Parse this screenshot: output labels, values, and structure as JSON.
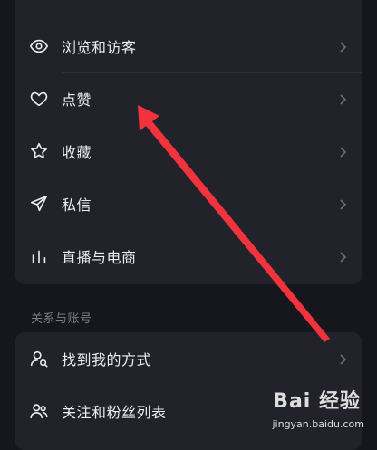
{
  "menu": {
    "items": [
      {
        "label": "浏览和访客",
        "icon": "eye-icon"
      },
      {
        "label": "点赞",
        "icon": "heart-icon"
      },
      {
        "label": "收藏",
        "icon": "star-icon"
      },
      {
        "label": "私信",
        "icon": "send-icon"
      },
      {
        "label": "直播与电商",
        "icon": "bar-chart-icon"
      }
    ]
  },
  "section": {
    "title": "关系与账号",
    "items": [
      {
        "label": "找到我的方式",
        "icon": "user-search-icon"
      },
      {
        "label": "关注和粉丝列表",
        "icon": "users-icon"
      }
    ]
  },
  "watermark": {
    "logo_text": "Bai 经验",
    "url": "jingyan.baidu.com"
  },
  "colors": {
    "background": "#16161d",
    "card": "#22222b",
    "annotation_arrow": "#f0333c"
  }
}
